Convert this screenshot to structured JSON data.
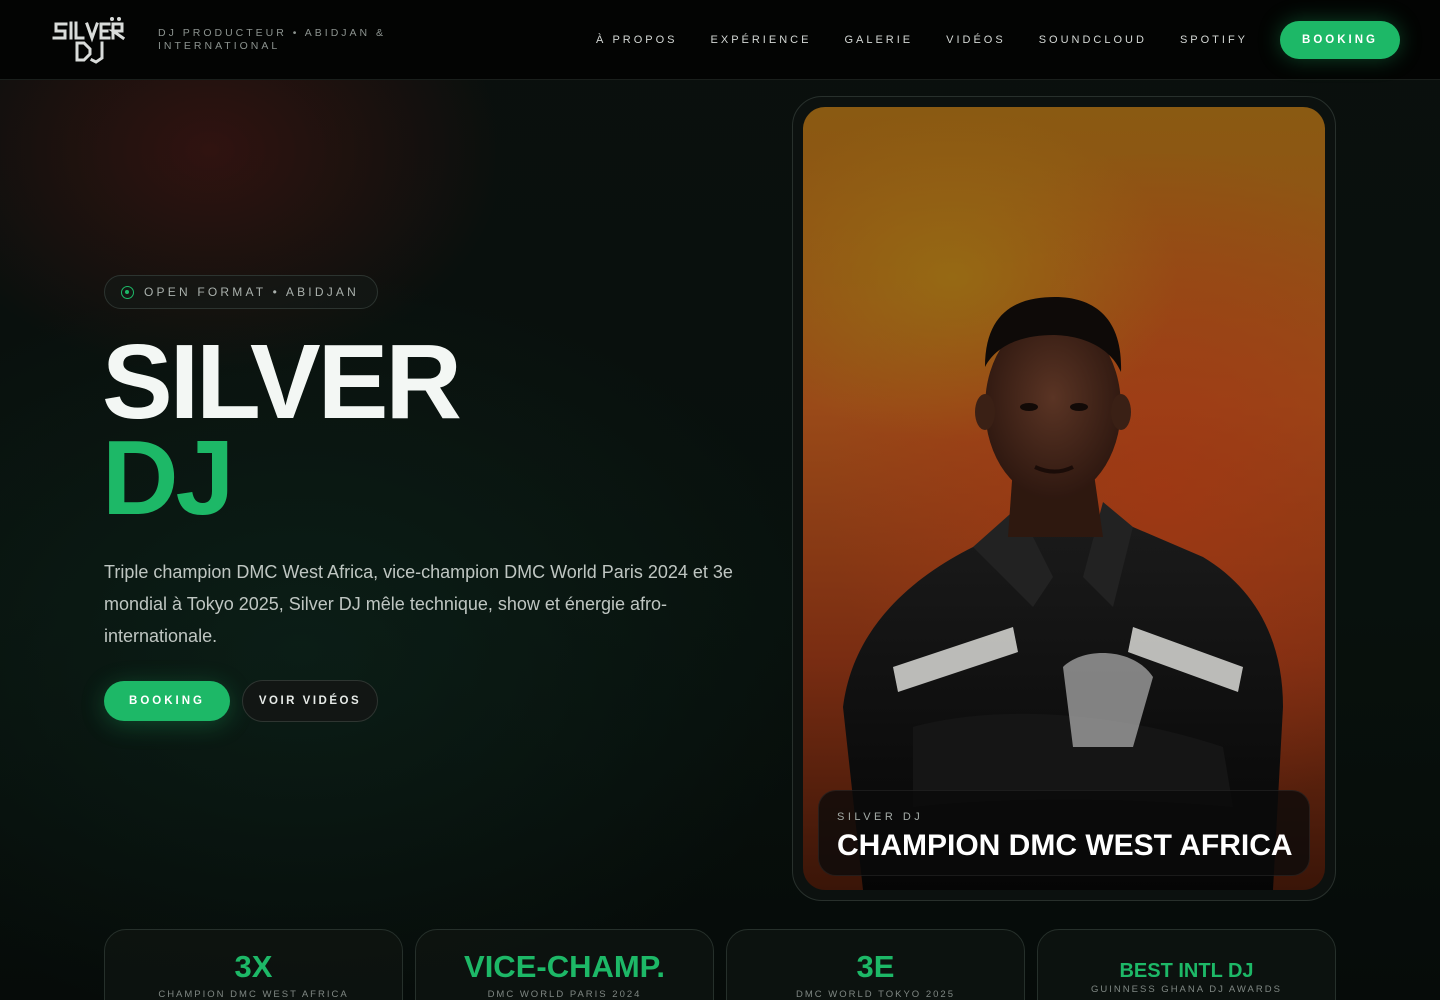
{
  "header": {
    "logo_text": "SILVER DJ",
    "tagline": "DJ PRODUCTEUR • ABIDJAN & INTERNATIONAL",
    "nav": [
      {
        "label": "À PROPOS"
      },
      {
        "label": "EXPÉRIENCE"
      },
      {
        "label": "GALERIE"
      },
      {
        "label": "VIDÉOS"
      },
      {
        "label": "SOUNDCLOUD"
      },
      {
        "label": "SPOTIFY"
      }
    ],
    "booking_label": "BOOKING"
  },
  "hero": {
    "badge_icon": "vinyl-record-icon",
    "badge_text": "OPEN FORMAT • ABIDJAN",
    "title_line1": "SILVER",
    "title_line2": "DJ",
    "description": "Triple champion DMC West Africa, vice-champion DMC World Paris 2024 et 3e mondial à Tokyo 2025, Silver DJ mêle technique, show et énergie afro-internationale.",
    "primary_button": "BOOKING",
    "secondary_button": "VOIR VIDÉOS"
  },
  "photo_card": {
    "kicker": "SILVER DJ",
    "title": "CHAMPION DMC WEST AFRICA"
  },
  "stats": [
    {
      "value": "3X",
      "label": "CHAMPION DMC WEST AFRICA"
    },
    {
      "value": "VICE-CHAMP.",
      "label": "DMC WORLD PARIS 2024"
    },
    {
      "value": "3E",
      "label": "DMC WORLD TOKYO 2025"
    },
    {
      "value": "BEST INTL DJ",
      "label": "GUINNESS GHANA DJ AWARDS"
    }
  ],
  "colors": {
    "accent": "#1db867",
    "background": "#070c0a",
    "header_bg": "#030403",
    "text_primary": "#f3f7f4",
    "text_muted": "#8c938f"
  }
}
